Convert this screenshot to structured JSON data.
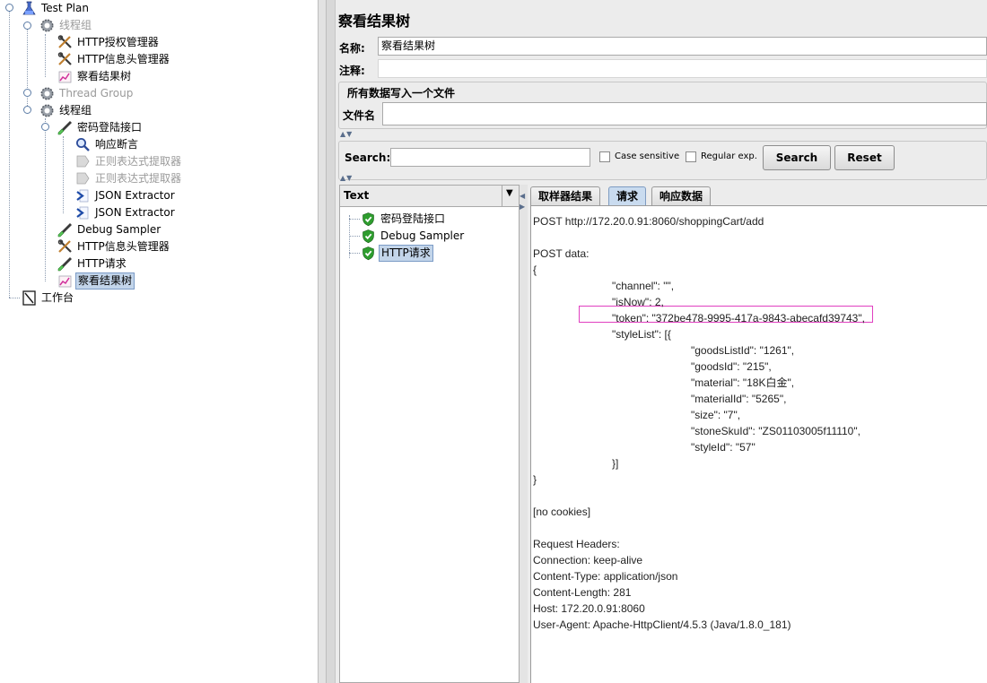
{
  "tree": {
    "nodes": [
      {
        "label": "Test Plan",
        "icon": "flask-icon",
        "state": "normal"
      },
      {
        "label": "线程组",
        "icon": "gear-icon",
        "state": "disabled"
      },
      {
        "label": "HTTP授权管理器",
        "icon": "wrench-icon",
        "state": "normal"
      },
      {
        "label": "HTTP信息头管理器",
        "icon": "wrench-icon",
        "state": "normal"
      },
      {
        "label": "察看结果树",
        "icon": "chart-icon",
        "state": "normal"
      },
      {
        "label": "Thread Group",
        "icon": "gear-icon",
        "state": "disabled"
      },
      {
        "label": "线程组",
        "icon": "gear-icon",
        "state": "normal"
      },
      {
        "label": "密码登陆接口",
        "icon": "pipette-icon",
        "state": "normal"
      },
      {
        "label": "响应断言",
        "icon": "magnifier-icon",
        "state": "normal"
      },
      {
        "label": "正则表达式提取器",
        "icon": "extractor-icon",
        "state": "disabled"
      },
      {
        "label": "正则表达式提取器",
        "icon": "extractor-icon",
        "state": "disabled"
      },
      {
        "label": "JSON Extractor",
        "icon": "extractor-icon",
        "state": "normal"
      },
      {
        "label": "JSON Extractor",
        "icon": "extractor-icon",
        "state": "normal"
      },
      {
        "label": "Debug Sampler",
        "icon": "pipette-icon",
        "state": "normal"
      },
      {
        "label": "HTTP信息头管理器",
        "icon": "wrench-icon",
        "state": "normal"
      },
      {
        "label": "HTTP请求",
        "icon": "pipette-icon",
        "state": "normal"
      },
      {
        "label": "察看结果树",
        "icon": "chart-icon",
        "state": "selected"
      },
      {
        "label": "工作台",
        "icon": "workbench-icon",
        "state": "normal"
      }
    ]
  },
  "panel": {
    "title": "察看结果树",
    "name_label": "名称:",
    "name_value": "察看结果树",
    "comment_label": "注释:",
    "comment_value": "",
    "file_group_title": "所有数据写入一个文件",
    "filename_label": "文件名",
    "filename_value": ""
  },
  "search": {
    "label": "Search:",
    "value": "",
    "case_label": "Case sensitive",
    "regex_label": "Regular exp.",
    "search_button": "Search",
    "reset_button": "Reset"
  },
  "results": {
    "renderer": "Text",
    "items": [
      {
        "label": "密码登陆接口",
        "status": "success"
      },
      {
        "label": "Debug Sampler",
        "status": "success"
      },
      {
        "label": "HTTP请求",
        "status": "success",
        "selected": true
      }
    ]
  },
  "tabs": [
    "取样器结果",
    "请求",
    "响应数据"
  ],
  "active_tab": "请求",
  "request": {
    "lines": [
      {
        "text": "POST http://172.20.0.91:8060/shoppingCart/add",
        "indent": 0
      },
      {
        "text": "",
        "indent": 0
      },
      {
        "text": "POST data:",
        "indent": 0
      },
      {
        "text": "{",
        "indent": 0
      },
      {
        "text": "\"channel\": \"\",",
        "indent": 1
      },
      {
        "text": "\"isNow\": 2,",
        "indent": 1
      },
      {
        "text": "\"token\": \"372be478-9995-417a-9843-abecafd39743\",",
        "indent": 1
      },
      {
        "text": "\"styleList\": [{",
        "indent": 1
      },
      {
        "text": "\"goodsListId\": \"1261\",",
        "indent": 2
      },
      {
        "text": "\"goodsId\": \"215\",",
        "indent": 2
      },
      {
        "text": "\"material\": \"18K白金\",",
        "indent": 2
      },
      {
        "text": "\"materialId\": \"5265\",",
        "indent": 2
      },
      {
        "text": "\"size\": \"7\",",
        "indent": 2
      },
      {
        "text": "\"stoneSkuId\": \"ZS01103005f11110\",",
        "indent": 2
      },
      {
        "text": "\"styleId\": \"57\"",
        "indent": 2
      },
      {
        "text": "}]",
        "indent": 1
      },
      {
        "text": "}",
        "indent": 0
      },
      {
        "text": "",
        "indent": 0
      },
      {
        "text": "[no cookies]",
        "indent": 0
      },
      {
        "text": "",
        "indent": 0
      },
      {
        "text": "Request Headers:",
        "indent": 0
      },
      {
        "text": "Connection: keep-alive",
        "indent": 0
      },
      {
        "text": "Content-Type: application/json",
        "indent": 0
      },
      {
        "text": "Content-Length: 281",
        "indent": 0
      },
      {
        "text": "Host: 172.20.0.91:8060",
        "indent": 0
      },
      {
        "text": "User-Agent: Apache-HttpClient/4.5.3 (Java/1.8.0_181)",
        "indent": 0
      }
    ]
  },
  "colors": {
    "highlight": "#e040c0",
    "selection": "#c3d5ea",
    "success_shield": "#2e9d2e"
  }
}
